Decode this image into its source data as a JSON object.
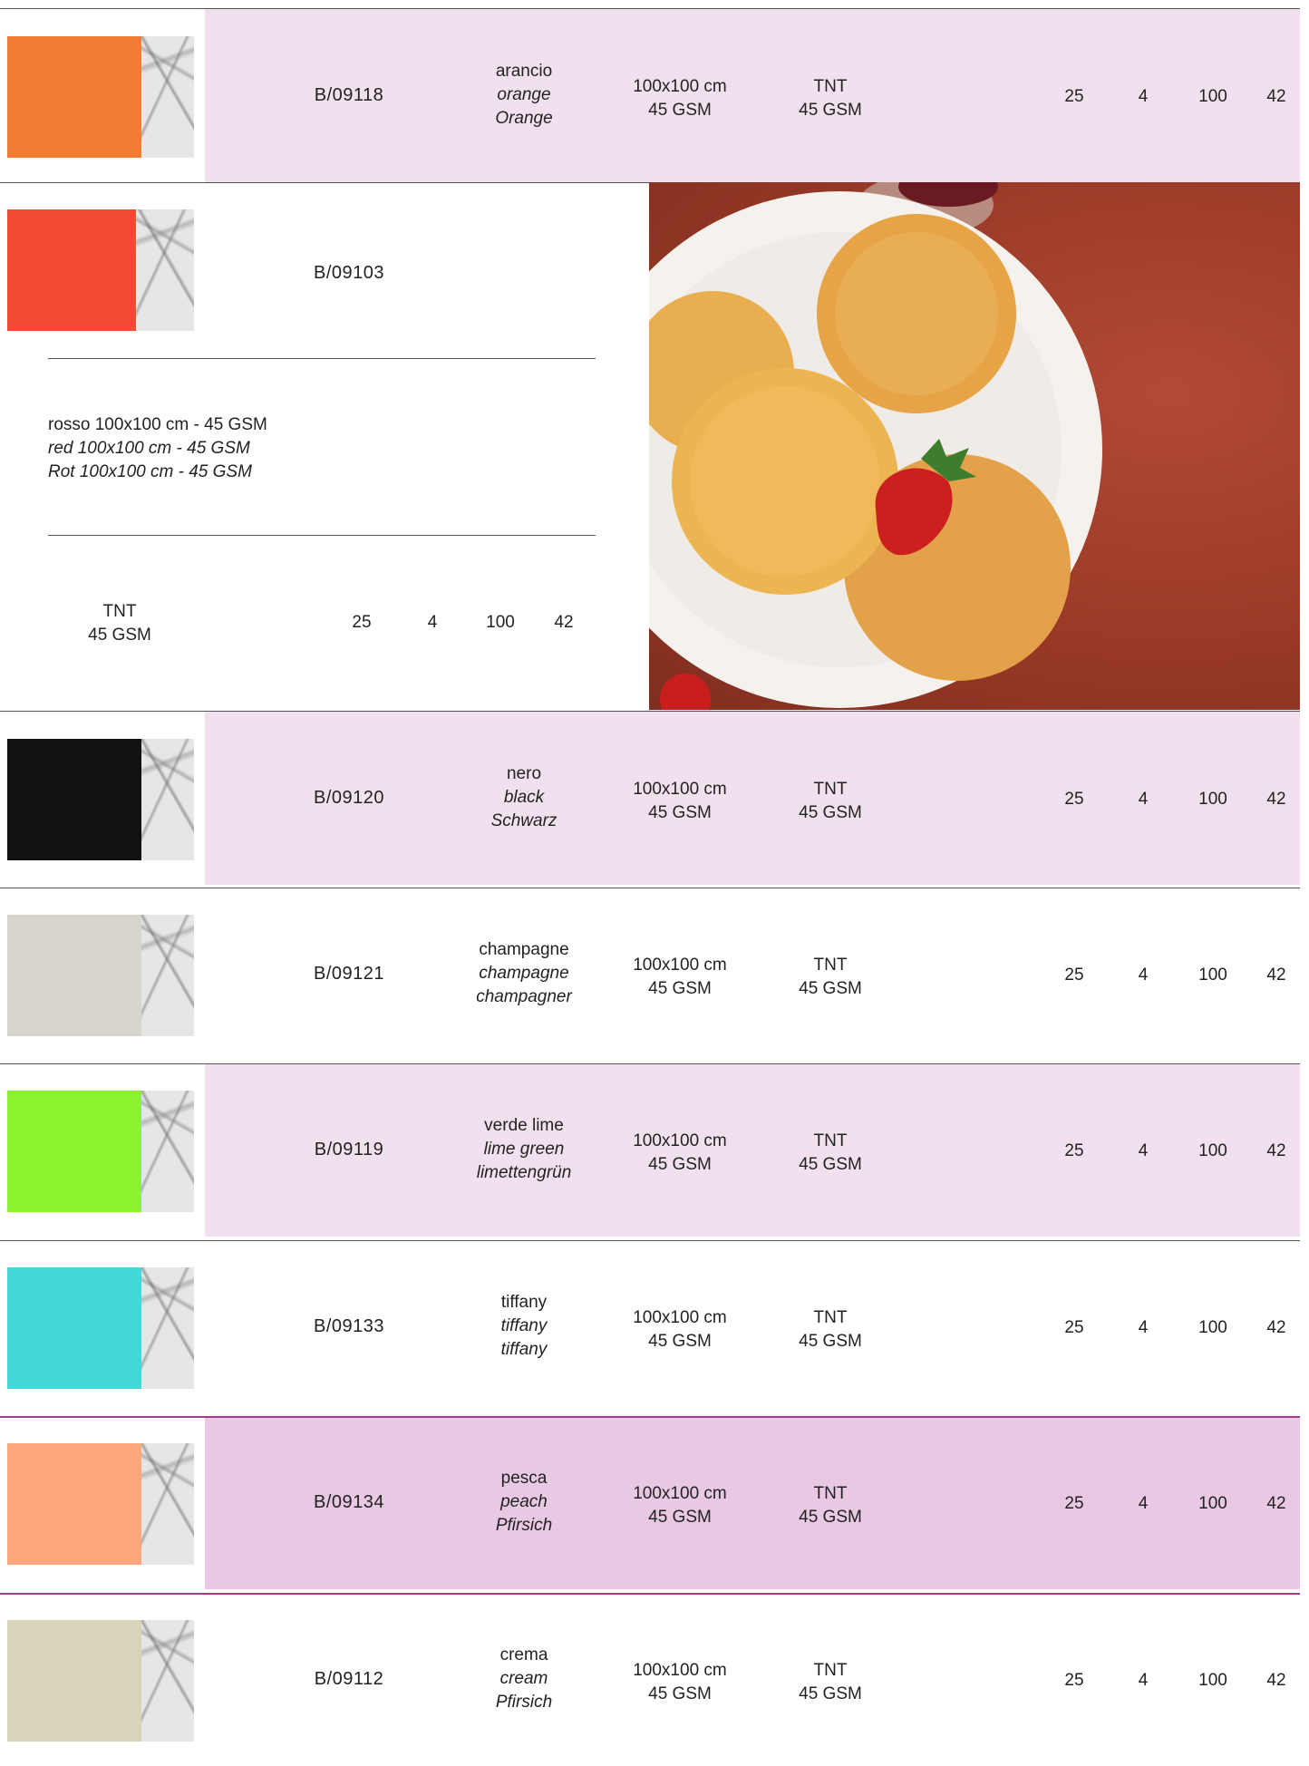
{
  "rows": [
    {
      "code": "B/09118",
      "it": "arancio",
      "en": "orange",
      "de": "Orange",
      "size1": "100x100 cm",
      "size2": "45 GSM",
      "mat1": "TNT",
      "mat2": "45 GSM",
      "q1": "25",
      "q2": "4",
      "q3": "100",
      "q4": "42",
      "color": "#f47c35",
      "bg": "#f1e1ef"
    },
    {
      "code": "B/09120",
      "it": "nero",
      "en": "black",
      "de": "Schwarz",
      "size1": "100x100 cm",
      "size2": "45 GSM",
      "mat1": "TNT",
      "mat2": "45 GSM",
      "q1": "25",
      "q2": "4",
      "q3": "100",
      "q4": "42",
      "color": "#111111",
      "bg": "#f1e1ef"
    },
    {
      "code": "B/09121",
      "it": "champagne",
      "en": "champagne",
      "de": "champagner",
      "size1": "100x100 cm",
      "size2": "45 GSM",
      "mat1": "TNT",
      "mat2": "45 GSM",
      "q1": "25",
      "q2": "4",
      "q3": "100",
      "q4": "42",
      "color": "#d8d6cc",
      "bg": "#ffffff"
    },
    {
      "code": "B/09119",
      "it": "verde lime",
      "en": "lime green",
      "de": "limettengrün",
      "size1": "100x100 cm",
      "size2": "45 GSM",
      "mat1": "TNT",
      "mat2": "45 GSM",
      "q1": "25",
      "q2": "4",
      "q3": "100",
      "q4": "42",
      "color": "#8cf22d",
      "bg": "#f1e1ef"
    },
    {
      "code": "B/09133",
      "it": "tiffany",
      "en": "tiffany",
      "de": "tiffany",
      "size1": "100x100 cm",
      "size2": "45 GSM",
      "mat1": "TNT",
      "mat2": "45 GSM",
      "q1": "25",
      "q2": "4",
      "q3": "100",
      "q4": "42",
      "color": "#43d8d8",
      "bg": "#ffffff"
    },
    {
      "code": "B/09134",
      "it": "pesca",
      "en": "peach",
      "de": "Pfirsich",
      "size1": "100x100 cm",
      "size2": "45 GSM",
      "mat1": "TNT",
      "mat2": "45 GSM",
      "q1": "25",
      "q2": "4",
      "q3": "100",
      "q4": "42",
      "color": "#fda57c",
      "bg": "#e8c8e2"
    },
    {
      "code": "B/09112",
      "it": "crema",
      "en": "cream",
      "de": "Pfirsich",
      "size1": "100x100 cm",
      "size2": "45 GSM",
      "mat1": "TNT",
      "mat2": "45 GSM",
      "q1": "25",
      "q2": "4",
      "q3": "100",
      "q4": "42",
      "color": "#d8d4ba",
      "bg": "#ffffff"
    }
  ],
  "red_row": {
    "code": "B/09103",
    "desc_it": "rosso 100x100 cm - 45 GSM",
    "desc_en": "red 100x100 cm - 45 GSM",
    "desc_de": "Rot 100x100 cm - 45 GSM",
    "mat1": "TNT",
    "mat2": "45 GSM",
    "q1": "25",
    "q2": "4",
    "q3": "100",
    "q4": "42",
    "color": "#f24a33"
  },
  "colors": {
    "row_tint": "#f1e1ef",
    "row_tint_dark": "#e8c8e2",
    "accent_line": "#a23c8f"
  }
}
